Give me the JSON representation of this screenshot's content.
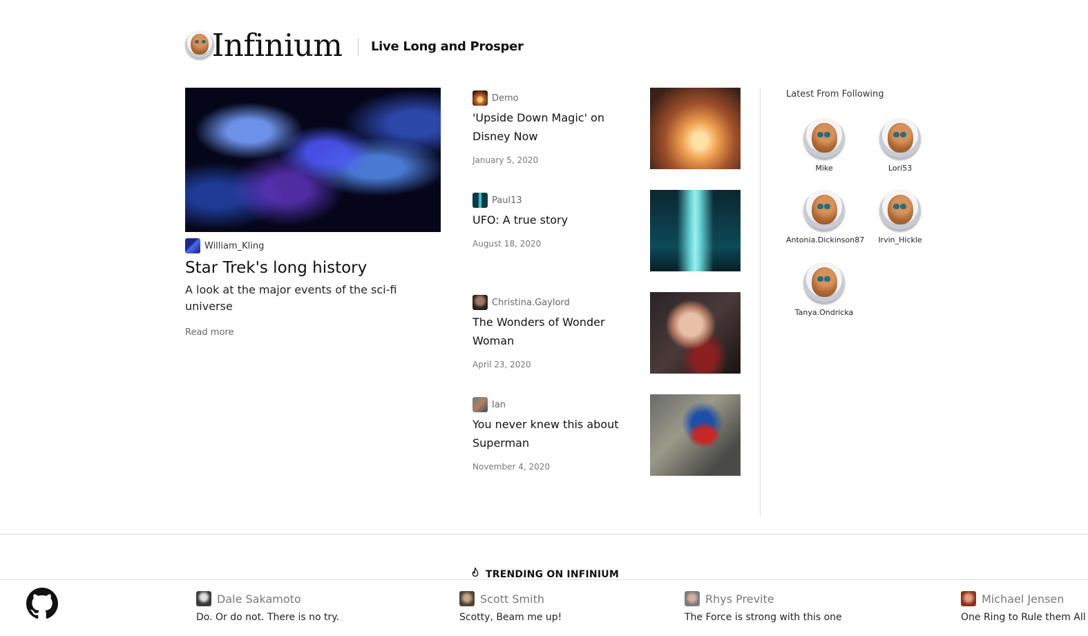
{
  "header": {
    "logo_symbol": "∞",
    "logo_text": "Infinium",
    "tagline": "Live Long and Prosper"
  },
  "featured": {
    "author": "William_Kling",
    "title": "Star Trek's long history",
    "description": "A look at the major events of the sci-fi universe",
    "read_more": "Read more"
  },
  "articles": [
    {
      "author": "Demo",
      "title": "'Upside Down Magic' on Disney Now",
      "date": "January 5, 2020"
    },
    {
      "author": "Paul13",
      "title": "UFO: A true story",
      "date": "August 18, 2020"
    },
    {
      "author": "Christina.Gaylord",
      "title": "The Wonders of Wonder Woman",
      "date": "April 23, 2020"
    },
    {
      "author": "Ian",
      "title": "You never knew this about Superman",
      "date": "November 4, 2020"
    }
  ],
  "following": {
    "title": "Latest From Following",
    "users": [
      "Mike",
      "Lori53",
      "Antonia.Dickinson87",
      "Irvin_Hickle",
      "Tanya.Ondricka"
    ]
  },
  "trending": {
    "heading": "TRENDING ON INFINIUM",
    "items": [
      {
        "name": "Dale Sakamoto",
        "quote": "Do. Or do not. There is no try."
      },
      {
        "name": "Scott Smith",
        "quote": "Scotty, Beam me up!"
      },
      {
        "name": "Rhys Previte",
        "quote": "The Force is strong with this one"
      },
      {
        "name": "Michael Jensen",
        "quote": "One Ring to Rule them All"
      }
    ]
  }
}
